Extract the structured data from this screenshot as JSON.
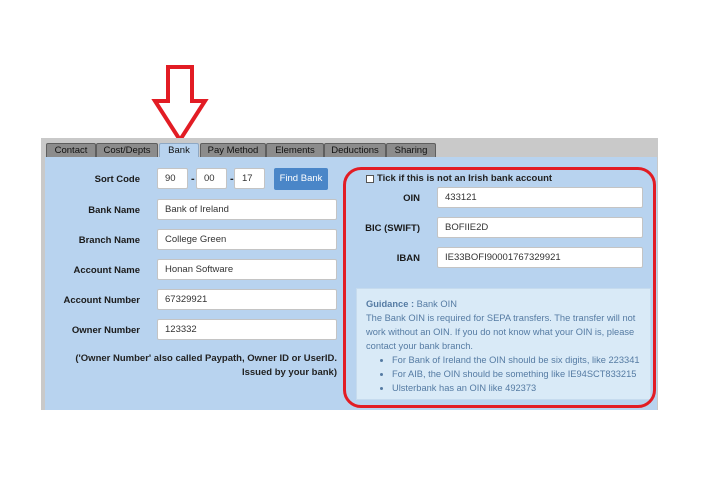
{
  "tabs": [
    "Contact",
    "Cost/Depts",
    "Bank",
    "Pay Method",
    "Elements",
    "Deductions",
    "Sharing"
  ],
  "left": {
    "sort_code_label": "Sort Code",
    "sort_code_1": "90",
    "sort_code_2": "00",
    "sort_code_3": "17",
    "find_bank_button": "Find Bank",
    "bank_name_label": "Bank Name",
    "bank_name_value": "Bank of Ireland",
    "branch_name_label": "Branch Name",
    "branch_name_value": "College Green",
    "account_name_label": "Account Name",
    "account_name_value": "Honan Software",
    "account_number_label": "Account Number",
    "account_number_value": "67329921",
    "owner_number_label": "Owner Number",
    "owner_number_value": "123332",
    "owner_note": "('Owner Number' also called Paypath, Owner ID or UserID. Issued by your bank)"
  },
  "right": {
    "checkbox_label": "Tick if this is not an Irish bank account",
    "oin_label": "OIN",
    "oin_value": "433121",
    "bic_label": "BIC (SWIFT)",
    "bic_value": "BOFIIE2D",
    "iban_label": "IBAN",
    "iban_value": "IE33BOFI90001767329921"
  },
  "guidance": {
    "title": "Guidance :",
    "subtitle": "Bank OIN",
    "body": "The Bank OIN is required for SEPA transfers. The transfer will not work without an OIN. If you do not know what your OIN is, please contact your bank branch.",
    "bullets": [
      "For Bank of Ireland the OIN should be six digits, like 223341",
      "For AIB, the OIN should be something like IE94SCT833215",
      "Ulsterbank has an OIN like 492373"
    ]
  },
  "colors": {
    "annotation_red": "#e21c24",
    "tab_active_bg": "#b8d3ef",
    "find_button_bg": "#4a86c8"
  }
}
